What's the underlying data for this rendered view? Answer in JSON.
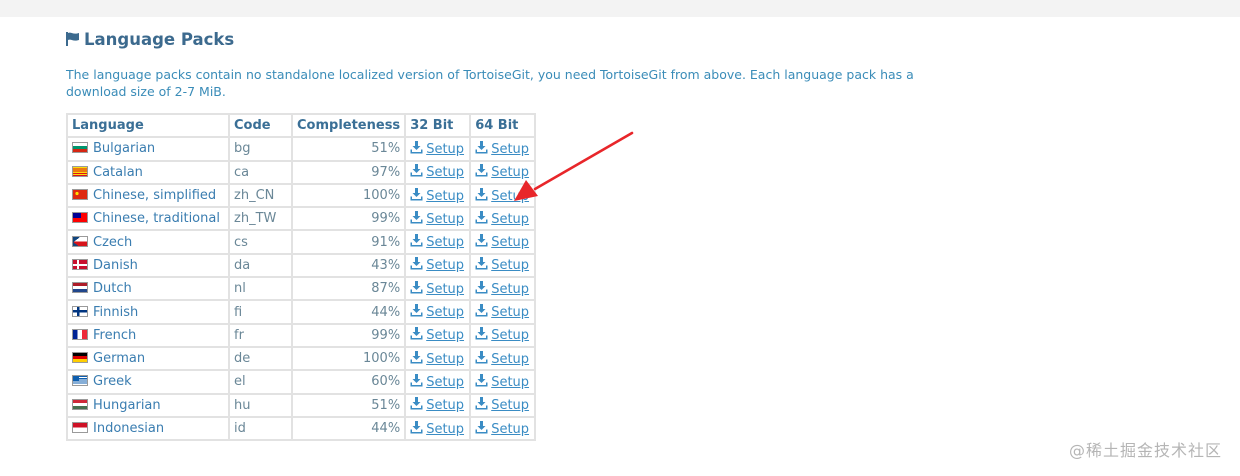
{
  "section": {
    "title": "Language Packs",
    "icon": "flag-icon",
    "intro": "The language packs contain no standalone localized version of TortoiseGit, you need TortoiseGit from above. Each language pack has a download size of 2-7 MiB."
  },
  "table": {
    "headers": [
      "Language",
      "Code",
      "Completeness",
      "32 Bit",
      "64 Bit"
    ],
    "download_icon": "download-icon",
    "rows": [
      {
        "language": "Bulgarian",
        "code": "bg",
        "completeness": "51%",
        "setup32": "Setup",
        "setup64": "Setup"
      },
      {
        "language": "Catalan",
        "code": "ca",
        "completeness": "97%",
        "setup32": "Setup",
        "setup64": "Setup"
      },
      {
        "language": "Chinese, simplified",
        "code": "zh_CN",
        "completeness": "100%",
        "setup32": "Setup",
        "setup64": "Setup"
      },
      {
        "language": "Chinese, traditional",
        "code": "zh_TW",
        "completeness": "99%",
        "setup32": "Setup",
        "setup64": "Setup"
      },
      {
        "language": "Czech",
        "code": "cs",
        "completeness": "91%",
        "setup32": "Setup",
        "setup64": "Setup"
      },
      {
        "language": "Danish",
        "code": "da",
        "completeness": "43%",
        "setup32": "Setup",
        "setup64": "Setup"
      },
      {
        "language": "Dutch",
        "code": "nl",
        "completeness": "87%",
        "setup32": "Setup",
        "setup64": "Setup"
      },
      {
        "language": "Finnish",
        "code": "fi",
        "completeness": "44%",
        "setup32": "Setup",
        "setup64": "Setup"
      },
      {
        "language": "French",
        "code": "fr",
        "completeness": "99%",
        "setup32": "Setup",
        "setup64": "Setup"
      },
      {
        "language": "German",
        "code": "de",
        "completeness": "100%",
        "setup32": "Setup",
        "setup64": "Setup"
      },
      {
        "language": "Greek",
        "code": "el",
        "completeness": "60%",
        "setup32": "Setup",
        "setup64": "Setup"
      },
      {
        "language": "Hungarian",
        "code": "hu",
        "completeness": "51%",
        "setup32": "Setup",
        "setup64": "Setup"
      },
      {
        "language": "Indonesian",
        "code": "id",
        "completeness": "44%",
        "setup32": "Setup",
        "setup64": "Setup"
      }
    ]
  },
  "annotation": {
    "arrow_color": "#e8262a"
  },
  "watermark": "@稀土掘金技术社区"
}
